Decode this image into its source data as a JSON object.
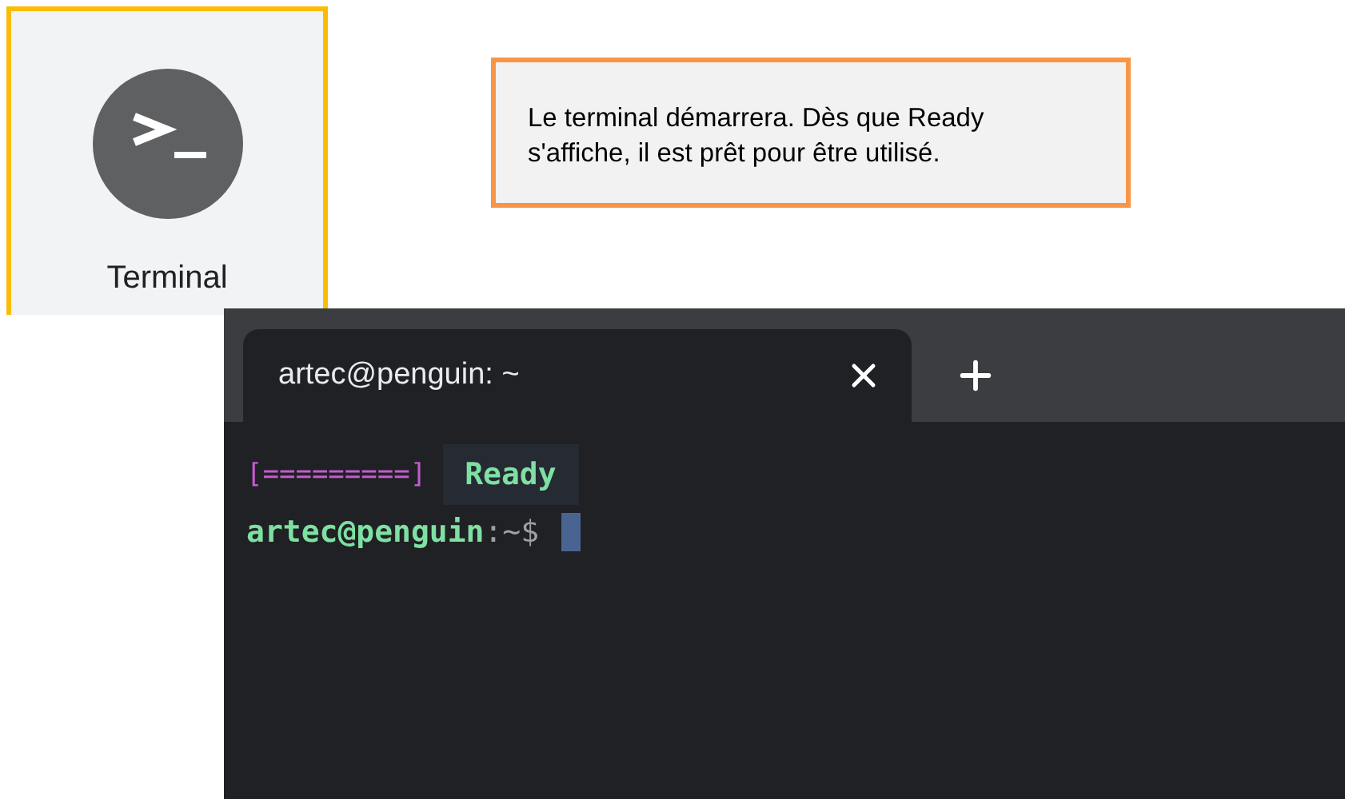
{
  "app_tile": {
    "label": "Terminal"
  },
  "callout": {
    "text": "Le terminal démarrera. Dès que Ready s'affiche, il est prêt pour être utilisé."
  },
  "terminal": {
    "tabs": [
      {
        "title": "artec@penguin: ~",
        "selected": true
      }
    ],
    "lines": [
      {
        "kind": "progress",
        "bar": "[=========]",
        "status": "Ready"
      },
      {
        "kind": "prompt",
        "user": "artec@penguin",
        "path": ":~$",
        "cursor": true
      }
    ]
  }
}
